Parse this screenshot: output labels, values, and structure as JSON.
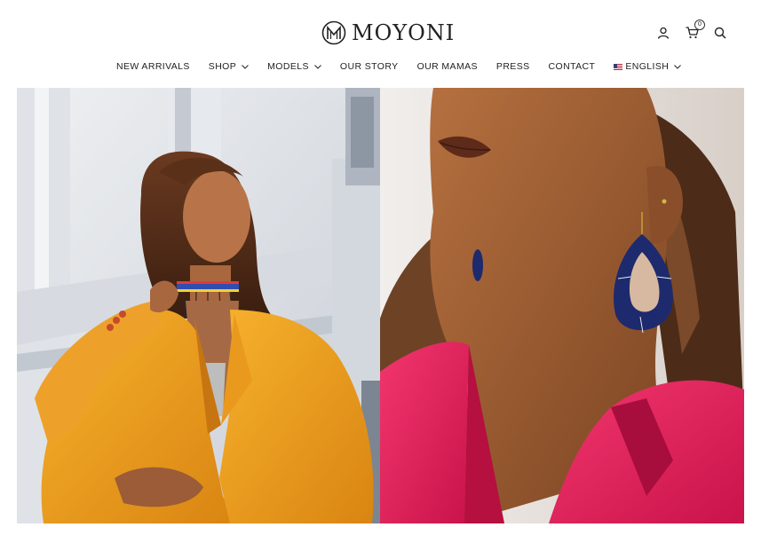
{
  "brand": {
    "name": "MOYONI",
    "color": "#222222"
  },
  "header": {
    "icons": [
      "account-icon",
      "cart-icon",
      "search-icon"
    ],
    "cart_count": "0"
  },
  "nav": {
    "items": [
      {
        "label": "NEW ARRIVALS",
        "dropdown": false
      },
      {
        "label": "SHOP",
        "dropdown": true
      },
      {
        "label": "MODELS",
        "dropdown": true
      },
      {
        "label": "OUR STORY",
        "dropdown": false
      },
      {
        "label": "OUR MAMAS",
        "dropdown": false
      },
      {
        "label": "PRESS",
        "dropdown": false
      },
      {
        "label": "CONTACT",
        "dropdown": false
      }
    ],
    "language": {
      "label": "ENGLISH",
      "flag": "us-flag-icon"
    }
  },
  "hero": {
    "left_photo": "woman-in-orange-blazer-with-beaded-choker",
    "right_photo": "woman-in-pink-blazer-with-blue-beaded-earring",
    "colors": {
      "orange_blazer": "#f0a020",
      "pink_blazer": "#e81e5c",
      "earring_blue": "#1e2a6e"
    }
  }
}
